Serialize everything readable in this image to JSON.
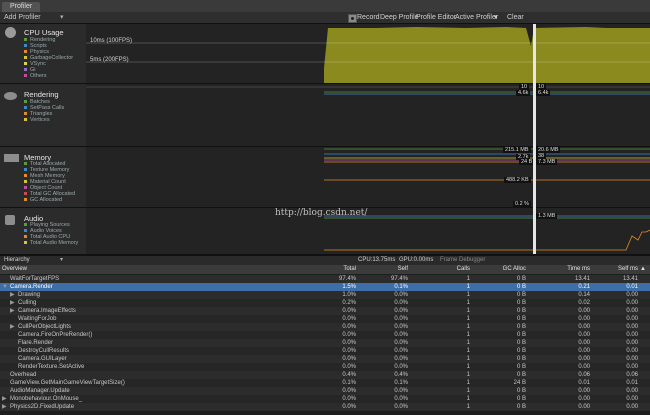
{
  "window": {
    "tab_title": "Profiler"
  },
  "toolbar": {
    "add_profiler": "Add Profiler",
    "record": "Record",
    "deep_profile": "Deep Profile",
    "profile_editor": "Profile Editor",
    "active_profiler": "Active Profiler",
    "clear": "Clear"
  },
  "modules": [
    {
      "title": "CPU Usage",
      "legend": [
        "Rendering",
        "Scripts",
        "Physics",
        "GarbageCollector",
        "VSync",
        "Gi",
        "Others"
      ],
      "colors": [
        "#5a9e3c",
        "#3f88c6",
        "#e08e28",
        "#d1c43a",
        "#d8d45a",
        "#9070c0",
        "#c04da0"
      ]
    },
    {
      "title": "Rendering",
      "legend": [
        "Batches",
        "SetPass Calls",
        "Triangles",
        "Vertices"
      ],
      "colors": [
        "#5a9e3c",
        "#3f88c6",
        "#e08e28",
        "#d1c43a"
      ]
    },
    {
      "title": "Memory",
      "legend": [
        "Total Allocated",
        "Texture Memory",
        "Mesh Memory",
        "Material Count",
        "Object Count",
        "Total GC Allocated",
        "GC Allocated"
      ],
      "colors": [
        "#5a9e3c",
        "#3f88c6",
        "#e08e28",
        "#d1c43a",
        "#c04da0",
        "#c85050",
        "#e08e28"
      ]
    },
    {
      "title": "Audio",
      "legend": [
        "Playing Sources",
        "Audio Voices",
        "Total Audio CPU",
        "Total Audio Memory"
      ],
      "colors": [
        "#5a9e3c",
        "#3f88c6",
        "#e08e28",
        "#d1c43a"
      ]
    }
  ],
  "cpu": {
    "label_10ms": "10ms (100FPS)",
    "label_5ms": "5ms (200FPS)"
  },
  "rendering_tags": [
    "10",
    "10",
    "4.6k",
    "6.4k"
  ],
  "memory_tags": [
    "215.1 MB",
    "20.6 MB",
    "2.7k",
    "38",
    "24 B",
    "7.3 MB",
    "488.2 KB"
  ],
  "audio_tags": [
    "1.3 MB",
    "0.2 %"
  ],
  "watermark": "http://blog.csdn.net/",
  "status": {
    "cpu": "CPU:13.75ms",
    "gpu": "GPU:0.00ms",
    "frame_debugger": "Frame Debugger"
  },
  "hierarchy": {
    "view_label": "Hierarchy",
    "columns": [
      "Overview",
      "Total",
      "Self",
      "Calls",
      "GC Alloc",
      "Time ms",
      "Self ms"
    ],
    "rows": [
      {
        "name": "WaitForTargetFPS",
        "indent": 0,
        "total": "97.4%",
        "self": "97.4%",
        "calls": "1",
        "gc": "0 B",
        "time": "13.41",
        "selfms": "13.41",
        "selected": false
      },
      {
        "name": "Camera.Render",
        "indent": 0,
        "total": "1.5%",
        "self": "0.1%",
        "calls": "1",
        "gc": "0 B",
        "time": "0.21",
        "selfms": "0.01",
        "selected": true
      },
      {
        "name": "Drawing",
        "indent": 1,
        "total": "1.0%",
        "self": "0.0%",
        "calls": "1",
        "gc": "0 B",
        "time": "0.14",
        "selfms": "0.00",
        "selected": false
      },
      {
        "name": "Culling",
        "indent": 1,
        "total": "0.2%",
        "self": "0.0%",
        "calls": "1",
        "gc": "0 B",
        "time": "0.02",
        "selfms": "0.00",
        "selected": false
      },
      {
        "name": "Camera.ImageEffects",
        "indent": 1,
        "total": "0.0%",
        "self": "0.0%",
        "calls": "1",
        "gc": "0 B",
        "time": "0.00",
        "selfms": "0.00",
        "selected": false
      },
      {
        "name": "WaitingForJob",
        "indent": 1,
        "total": "0.0%",
        "self": "0.0%",
        "calls": "1",
        "gc": "0 B",
        "time": "0.00",
        "selfms": "0.00",
        "selected": false
      },
      {
        "name": "CullPerObjectLights",
        "indent": 1,
        "total": "0.0%",
        "self": "0.0%",
        "calls": "1",
        "gc": "0 B",
        "time": "0.00",
        "selfms": "0.00",
        "selected": false
      },
      {
        "name": "Camera.FireOnPreRender()",
        "indent": 1,
        "total": "0.0%",
        "self": "0.0%",
        "calls": "1",
        "gc": "0 B",
        "time": "0.00",
        "selfms": "0.00",
        "selected": false
      },
      {
        "name": "Flare.Render",
        "indent": 1,
        "total": "0.0%",
        "self": "0.0%",
        "calls": "1",
        "gc": "0 B",
        "time": "0.00",
        "selfms": "0.00",
        "selected": false
      },
      {
        "name": "DestroyCullResults",
        "indent": 1,
        "total": "0.0%",
        "self": "0.0%",
        "calls": "1",
        "gc": "0 B",
        "time": "0.00",
        "selfms": "0.00",
        "selected": false
      },
      {
        "name": "Camera.GUILayer",
        "indent": 1,
        "total": "0.0%",
        "self": "0.0%",
        "calls": "1",
        "gc": "0 B",
        "time": "0.00",
        "selfms": "0.00",
        "selected": false
      },
      {
        "name": "RenderTexture.SetActive",
        "indent": 1,
        "total": "0.0%",
        "self": "0.0%",
        "calls": "1",
        "gc": "0 B",
        "time": "0.00",
        "selfms": "0.00",
        "selected": false
      },
      {
        "name": "Overhead",
        "indent": 0,
        "total": "0.4%",
        "self": "0.4%",
        "calls": "1",
        "gc": "0 B",
        "time": "0.06",
        "selfms": "0.06",
        "selected": false
      },
      {
        "name": "GameView.GetMainGameViewTargetSize()",
        "indent": 0,
        "total": "0.1%",
        "self": "0.1%",
        "calls": "1",
        "gc": "24 B",
        "time": "0.01",
        "selfms": "0.01",
        "selected": false
      },
      {
        "name": "AudioManager.Update",
        "indent": 0,
        "total": "0.0%",
        "self": "0.0%",
        "calls": "1",
        "gc": "0 B",
        "time": "0.00",
        "selfms": "0.00",
        "selected": false
      },
      {
        "name": "Monobehaviour.OnMouse_",
        "indent": 0,
        "total": "0.0%",
        "self": "0.0%",
        "calls": "1",
        "gc": "0 B",
        "time": "0.00",
        "selfms": "0.00",
        "selected": false
      },
      {
        "name": "Physics2D.FixedUpdate",
        "indent": 0,
        "total": "0.0%",
        "self": "0.0%",
        "calls": "1",
        "gc": "0 B",
        "time": "0.00",
        "selfms": "0.00",
        "selected": false
      }
    ]
  }
}
